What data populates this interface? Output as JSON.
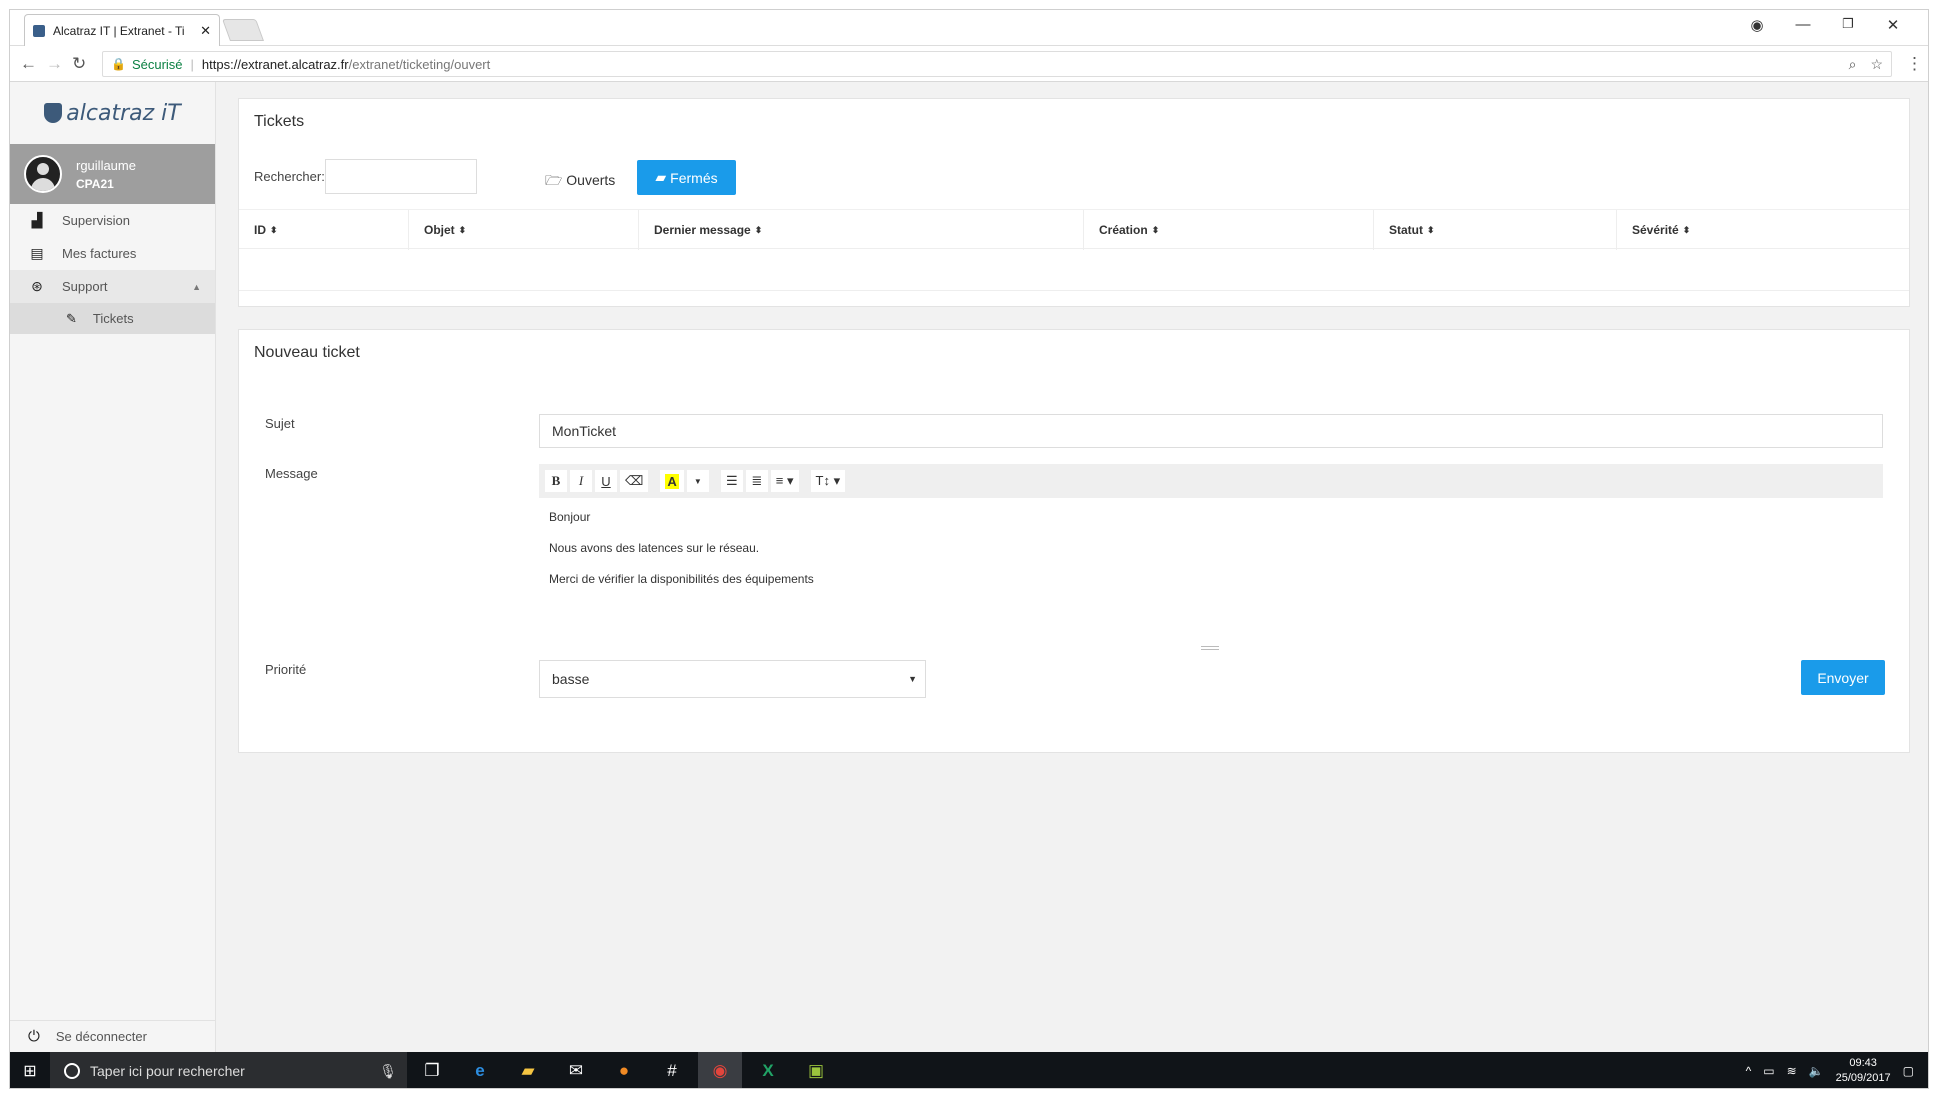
{
  "browser": {
    "tab_title": "Alcatraz IT | Extranet - Ti",
    "secure_label": "Sécurisé",
    "url_host": "https://extranet.alcatraz.fr",
    "url_path": "/extranet/ticketing/ouvert"
  },
  "sidebar": {
    "logo_text": "alcatraz iT",
    "user_name": "rguillaume",
    "user_company": "CPA21",
    "items": [
      {
        "label": "Supervision",
        "icon": "area-chart-icon"
      },
      {
        "label": "Mes factures",
        "icon": "file-icon"
      },
      {
        "label": "Support",
        "icon": "life-ring-icon"
      }
    ],
    "sub_items": [
      {
        "label": "Tickets",
        "icon": "ticket-icon"
      }
    ],
    "logout_label": "Se déconnecter"
  },
  "tickets": {
    "title": "Tickets",
    "search_label": "Rechercher:",
    "search_value": "",
    "open_button": "Ouverts",
    "closed_button": "Fermés",
    "columns": [
      "ID",
      "Objet",
      "Dernier message",
      "Création",
      "Statut",
      "Sévérité"
    ],
    "rows": []
  },
  "new_ticket": {
    "title": "Nouveau ticket",
    "subject_label": "Sujet",
    "subject_value": "MonTicket",
    "message_label": "Message",
    "message_lines": [
      "Bonjour",
      "Nous avons des latences sur le réseau.",
      "Merci de vérifier la disponibilités des équipements"
    ],
    "priority_label": "Priorité",
    "priority_value": "basse",
    "send_button": "Envoyer"
  },
  "taskbar": {
    "search_placeholder": "Taper ici pour rechercher",
    "time": "09:43",
    "date": "25/09/2017"
  },
  "colors": {
    "accent": "#1a9bea",
    "sidebar_user_bg": "#9e9e9e"
  }
}
